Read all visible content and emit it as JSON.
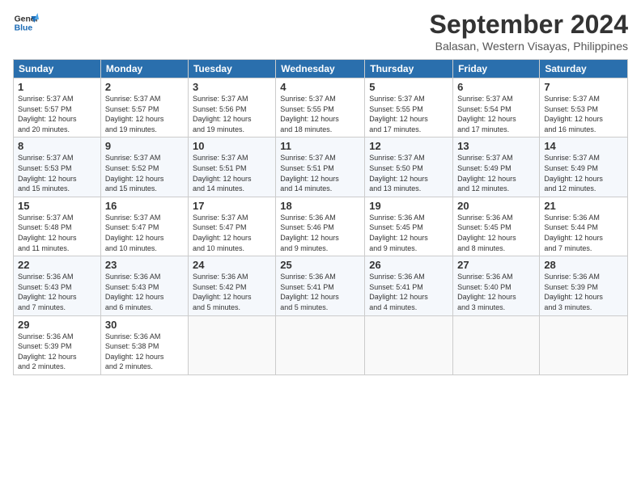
{
  "header": {
    "logo_line1": "General",
    "logo_line2": "Blue",
    "month_year": "September 2024",
    "location": "Balasan, Western Visayas, Philippines"
  },
  "days_of_week": [
    "Sunday",
    "Monday",
    "Tuesday",
    "Wednesday",
    "Thursday",
    "Friday",
    "Saturday"
  ],
  "weeks": [
    [
      {
        "day": "1",
        "sunrise": "5:37 AM",
        "sunset": "5:57 PM",
        "daylight": "12 hours and 20 minutes."
      },
      {
        "day": "2",
        "sunrise": "5:37 AM",
        "sunset": "5:57 PM",
        "daylight": "12 hours and 19 minutes."
      },
      {
        "day": "3",
        "sunrise": "5:37 AM",
        "sunset": "5:56 PM",
        "daylight": "12 hours and 19 minutes."
      },
      {
        "day": "4",
        "sunrise": "5:37 AM",
        "sunset": "5:55 PM",
        "daylight": "12 hours and 18 minutes."
      },
      {
        "day": "5",
        "sunrise": "5:37 AM",
        "sunset": "5:55 PM",
        "daylight": "12 hours and 17 minutes."
      },
      {
        "day": "6",
        "sunrise": "5:37 AM",
        "sunset": "5:54 PM",
        "daylight": "12 hours and 17 minutes."
      },
      {
        "day": "7",
        "sunrise": "5:37 AM",
        "sunset": "5:53 PM",
        "daylight": "12 hours and 16 minutes."
      }
    ],
    [
      {
        "day": "8",
        "sunrise": "5:37 AM",
        "sunset": "5:53 PM",
        "daylight": "12 hours and 15 minutes."
      },
      {
        "day": "9",
        "sunrise": "5:37 AM",
        "sunset": "5:52 PM",
        "daylight": "12 hours and 15 minutes."
      },
      {
        "day": "10",
        "sunrise": "5:37 AM",
        "sunset": "5:51 PM",
        "daylight": "12 hours and 14 minutes."
      },
      {
        "day": "11",
        "sunrise": "5:37 AM",
        "sunset": "5:51 PM",
        "daylight": "12 hours and 14 minutes."
      },
      {
        "day": "12",
        "sunrise": "5:37 AM",
        "sunset": "5:50 PM",
        "daylight": "12 hours and 13 minutes."
      },
      {
        "day": "13",
        "sunrise": "5:37 AM",
        "sunset": "5:49 PM",
        "daylight": "12 hours and 12 minutes."
      },
      {
        "day": "14",
        "sunrise": "5:37 AM",
        "sunset": "5:49 PM",
        "daylight": "12 hours and 12 minutes."
      }
    ],
    [
      {
        "day": "15",
        "sunrise": "5:37 AM",
        "sunset": "5:48 PM",
        "daylight": "12 hours and 11 minutes."
      },
      {
        "day": "16",
        "sunrise": "5:37 AM",
        "sunset": "5:47 PM",
        "daylight": "12 hours and 10 minutes."
      },
      {
        "day": "17",
        "sunrise": "5:37 AM",
        "sunset": "5:47 PM",
        "daylight": "12 hours and 10 minutes."
      },
      {
        "day": "18",
        "sunrise": "5:36 AM",
        "sunset": "5:46 PM",
        "daylight": "12 hours and 9 minutes."
      },
      {
        "day": "19",
        "sunrise": "5:36 AM",
        "sunset": "5:45 PM",
        "daylight": "12 hours and 9 minutes."
      },
      {
        "day": "20",
        "sunrise": "5:36 AM",
        "sunset": "5:45 PM",
        "daylight": "12 hours and 8 minutes."
      },
      {
        "day": "21",
        "sunrise": "5:36 AM",
        "sunset": "5:44 PM",
        "daylight": "12 hours and 7 minutes."
      }
    ],
    [
      {
        "day": "22",
        "sunrise": "5:36 AM",
        "sunset": "5:43 PM",
        "daylight": "12 hours and 7 minutes."
      },
      {
        "day": "23",
        "sunrise": "5:36 AM",
        "sunset": "5:43 PM",
        "daylight": "12 hours and 6 minutes."
      },
      {
        "day": "24",
        "sunrise": "5:36 AM",
        "sunset": "5:42 PM",
        "daylight": "12 hours and 5 minutes."
      },
      {
        "day": "25",
        "sunrise": "5:36 AM",
        "sunset": "5:41 PM",
        "daylight": "12 hours and 5 minutes."
      },
      {
        "day": "26",
        "sunrise": "5:36 AM",
        "sunset": "5:41 PM",
        "daylight": "12 hours and 4 minutes."
      },
      {
        "day": "27",
        "sunrise": "5:36 AM",
        "sunset": "5:40 PM",
        "daylight": "12 hours and 3 minutes."
      },
      {
        "day": "28",
        "sunrise": "5:36 AM",
        "sunset": "5:39 PM",
        "daylight": "12 hours and 3 minutes."
      }
    ],
    [
      {
        "day": "29",
        "sunrise": "5:36 AM",
        "sunset": "5:39 PM",
        "daylight": "12 hours and 2 minutes."
      },
      {
        "day": "30",
        "sunrise": "5:36 AM",
        "sunset": "5:38 PM",
        "daylight": "12 hours and 2 minutes."
      },
      null,
      null,
      null,
      null,
      null
    ]
  ],
  "labels": {
    "sunrise": "Sunrise:",
    "sunset": "Sunset:",
    "daylight": "Daylight:"
  }
}
